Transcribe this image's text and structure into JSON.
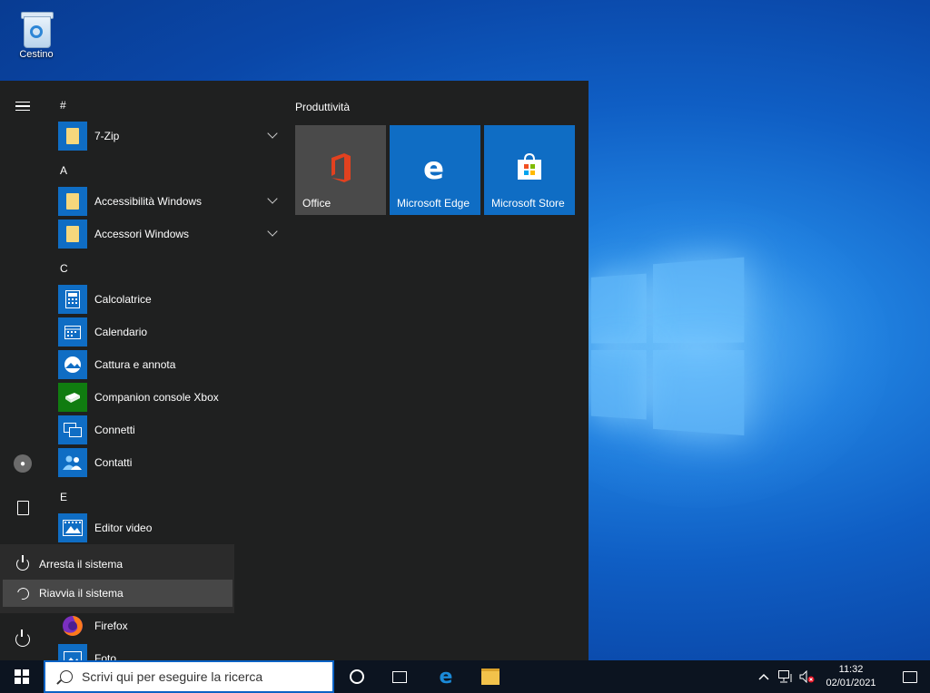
{
  "desktop": {
    "recycle_bin_label": "Cestino"
  },
  "start_menu": {
    "sections": {
      "hash": "#",
      "a": "A",
      "c": "C",
      "e": "E"
    },
    "apps": {
      "zip": "7-Zip",
      "accessibility": "Accessibilità Windows",
      "accessories": "Accessori Windows",
      "calculator": "Calcolatrice",
      "calendar": "Calendario",
      "snip": "Cattura e annota",
      "xbox": "Companion console Xbox",
      "connect": "Connetti",
      "contacts": "Contatti",
      "video_editor": "Editor video",
      "firefox": "Firefox",
      "photos": "Foto"
    },
    "tiles_group": "Produttività",
    "tiles": {
      "office": "Office",
      "edge": "Microsoft Edge",
      "store": "Microsoft Store"
    },
    "power_menu": {
      "shutdown": "Arresta il sistema",
      "restart": "Riavvia il sistema"
    }
  },
  "taskbar": {
    "search_placeholder": "Scrivi qui per eseguire la ricerca",
    "time": "11:32",
    "date": "02/01/2021"
  },
  "colors": {
    "accent": "#0f6dc4",
    "start_bg": "#1f2020",
    "taskbar_bg": "#0c1420"
  }
}
